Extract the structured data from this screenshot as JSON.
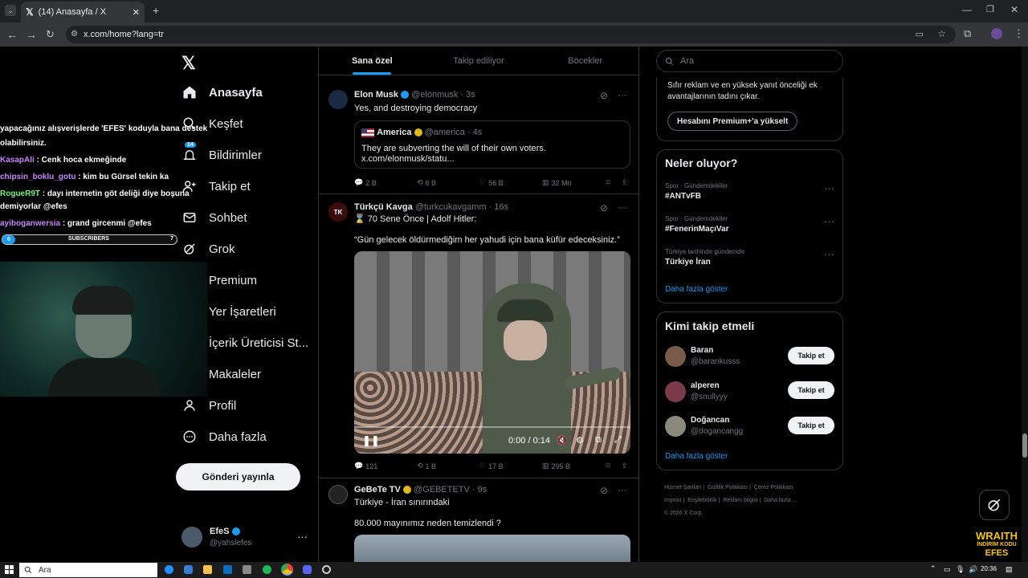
{
  "browser": {
    "tab_title": "(14) Anasayfa / X",
    "url": "x.com/home?lang=tr"
  },
  "nav": {
    "items": [
      {
        "label": "Anasayfa",
        "icon": "home-icon"
      },
      {
        "label": "Keşfet",
        "icon": "search-icon"
      },
      {
        "label": "Bildirimler",
        "icon": "bell-icon",
        "badge": "14"
      },
      {
        "label": "Takip et",
        "icon": "add-person-icon"
      },
      {
        "label": "Sohbet",
        "icon": "mail-icon"
      },
      {
        "label": "Grok",
        "icon": "grok-icon"
      },
      {
        "label": "Premium",
        "icon": "x-logo-icon"
      },
      {
        "label": "Yer İşaretleri",
        "icon": "bookmark-icon"
      },
      {
        "label": "İçerik Üreticisi St...",
        "icon": "lightning-icon"
      },
      {
        "label": "Makaleler",
        "icon": "article-icon"
      },
      {
        "label": "Profil",
        "icon": "person-icon"
      },
      {
        "label": "Daha fazla",
        "icon": "more-circle-icon"
      }
    ],
    "post_button": "Gönderi yayınla",
    "account_name": "EfeS",
    "account_handle": "@yahslefes"
  },
  "timeline": {
    "tabs": [
      "Sana özel",
      "Takip ediliyor",
      "Böcekler"
    ],
    "tweets": [
      {
        "name": "Elon Musk",
        "meta": "@elonmusk · 3s",
        "text": "Yes, and destroying democracy",
        "quote": {
          "name": "America",
          "meta": "@america · 4s",
          "text": "They are subverting the will of their own voters.",
          "link": "x.com/elonmusk/statu..."
        },
        "replies": "2 B",
        "reposts": "6 B",
        "likes": "56 B",
        "views": "32 Mn"
      },
      {
        "name": "Türkçü Kavga",
        "meta": "@turkcukavgamm · 16s",
        "line1": "⌛ 70 Sene Önce | Adolf Hitler:",
        "line2": "“Gün gelecek öldürmediğim her yahudi için bana küfür edeceksiniz.”",
        "video_time": "0:00 / 0:14",
        "replies": "121",
        "reposts": "1 B",
        "likes": "17 B",
        "views": "295 B"
      },
      {
        "name": "GeBeTe TV",
        "meta": "@GEBETETV · 9s",
        "line1": "Türkiye - İran sınırındaki",
        "line2": "80.000 mayınımız neden temizlendi ?"
      }
    ]
  },
  "sidebar": {
    "search_placeholder": "Ara",
    "premium_text": "Sıfır reklam ve en yüksek yanıt önceliği ek avantajlarının tadını çıkar.",
    "premium_button": "Hesabını Premium+'a yükselt",
    "trends_title": "Neler oluyor?",
    "trends": [
      {
        "category": "Spor · Gündemdekiler",
        "name": "#ANTvFB"
      },
      {
        "category": "Spor · Gündemdekiler",
        "name": "#FenerinMaçıVar"
      },
      {
        "category": "Türkiye tarihinde gündemde",
        "name": "Türkiye İran"
      }
    ],
    "show_more": "Daha fazla göster",
    "follow_title": "Kimi takip etmeli",
    "follow": [
      {
        "name": "Baran",
        "handle": "@barankusss",
        "button": "Takip et"
      },
      {
        "name": "alperen",
        "handle": "@snullyyy",
        "button": "Takip et"
      },
      {
        "name": "Doğancan",
        "handle": "@dogancangg",
        "button": "Takip et"
      }
    ],
    "footer": [
      "Hizmet Şartları",
      "Gizlilik Politikası",
      "Çerez Politikası",
      "Imprint",
      "Erişilebilirlik",
      "Reklam bilgisi",
      "Daha fazla ...",
      "© 2026 X Corp."
    ]
  },
  "overlay": {
    "chat": [
      {
        "user": "",
        "text": "yapacağınız alışverişlerde 'EFES' koduyla bana destek"
      },
      {
        "user": "",
        "text": "olabilirsiniz."
      },
      {
        "user": "KasapAli",
        "text": ": Cenk hoca ekmeğinde",
        "color": "#c586f5"
      },
      {
        "user": "chipsin_boklu_gotu",
        "text": ": kim bu Gürsel tekin ka",
        "color": "#c586f5"
      },
      {
        "user": "RogueR9T",
        "text": ": dayı internetin göt deliği diye boşuna",
        "color": "#7cf27c"
      },
      {
        "user": "",
        "text": "demiyorlar @efes"
      },
      {
        "user": "ayiboganwersia",
        "text": ": grand gircenmi @efes",
        "color": "#c586f5"
      }
    ],
    "subs_label": "SUBSCRIBERS",
    "subs_left": "0",
    "subs_right": "7",
    "brand_line1": "WRAITH",
    "brand_line2": "İNDİRİM KODU",
    "brand_line3": "EFES"
  },
  "taskbar": {
    "search": "Ara",
    "time": "20:36"
  }
}
